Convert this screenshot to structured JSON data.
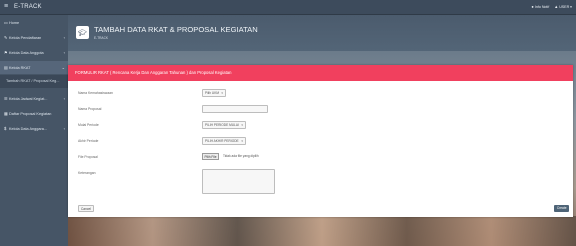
{
  "app": {
    "brand": "E-TRACK"
  },
  "topbar": {
    "items": [
      {
        "icon": "bell-icon",
        "label": "Info Notif"
      },
      {
        "icon": "user-icon",
        "label": "USER"
      }
    ]
  },
  "sidebar": {
    "items": [
      {
        "icon": "monitor-icon",
        "label": "Home",
        "chevron": ""
      },
      {
        "icon": "wrench-icon",
        "label": "Kelola Pendaftaran",
        "chevron": "‹"
      },
      {
        "icon": "flag-icon",
        "label": "Kelola Data Anggota",
        "chevron": "‹"
      },
      {
        "icon": "book-icon",
        "label": "Kelola RKAT",
        "chevron": "⌄"
      },
      {
        "icon": "",
        "label": "Tambah RKAT / Proposal Keg...",
        "chevron": ""
      },
      {
        "icon": "list-icon",
        "label": "Kelola Jadwal Kegiat...",
        "chevron": "‹"
      },
      {
        "icon": "table-icon",
        "label": "Daftar Proposal Kegiatan",
        "chevron": ""
      },
      {
        "icon": "dollar-icon",
        "label": "Kelola Data Anggara...",
        "chevron": "‹"
      }
    ]
  },
  "header": {
    "title": "TAMBAH DATA RKAT & PROPOSAL KEGIATAN",
    "breadcrumb": "E-TRACK"
  },
  "form": {
    "heading": "FORMULIR RKAT ( Rencana Kerja Dan Anggaran Tahunan ) dan Proposal Kegiatan",
    "fields": [
      {
        "label": "Nama Kemahasiswaan",
        "value": "Pilih UKM",
        "type": "select"
      },
      {
        "label": "Nama Proposal",
        "value": "",
        "type": "text"
      },
      {
        "label": "Mulai Periode",
        "value": "PILIH PERIODE MULAI",
        "type": "select"
      },
      {
        "label": "Akhir Periode",
        "value": "PILIH AKHIR PERIODE",
        "type": "select"
      },
      {
        "label": "File Proposal",
        "value": "",
        "type": "file"
      },
      {
        "label": "Keterangan",
        "value": "",
        "type": "textarea"
      }
    ],
    "file_button": "Pilih File",
    "file_note": "Tidak ada file yang dipilih",
    "cancel_label": "Cancel",
    "save_label": "Create"
  },
  "colors": {
    "header_accent": "#f1405e",
    "sidebar": "#465566",
    "topbar": "#3d4b5c",
    "save_button": "#4e6477"
  }
}
